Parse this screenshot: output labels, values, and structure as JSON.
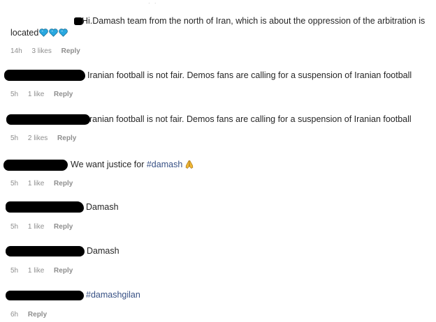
{
  "comments": [
    {
      "text_line1": "Hi.Damash team from the north of Iran, which is about the oppression of the arbitration is",
      "text_line2": "located",
      "time": "14h",
      "likes": "3 likes",
      "reply": "Reply"
    },
    {
      "text": "Iranian football is not fair. Demos fans are calling for a suspension of Iranian football",
      "time": "5h",
      "likes": "1 like",
      "reply": "Reply"
    },
    {
      "text": "ranian football is not fair. Demos fans are calling for a suspension of Iranian football",
      "time": "5h",
      "likes": "2 likes",
      "reply": "Reply"
    },
    {
      "text": "We want justice for ",
      "hashtag": "#damash",
      "time": "5h",
      "likes": "1 like",
      "reply": "Reply"
    },
    {
      "text": "Damash",
      "time": "5h",
      "likes": "1 like",
      "reply": "Reply"
    },
    {
      "text": "Damash",
      "time": "5h",
      "likes": "1 like",
      "reply": "Reply"
    },
    {
      "hashtag": "#damashgilan",
      "time": "6h",
      "reply": "Reply"
    }
  ],
  "colors": {
    "hashtag": "#385185",
    "meta": "#8e8e8e",
    "heart": "#29a8e0"
  },
  "icons": {
    "hearts": "blue-heart-icon",
    "pray": "folded-hands-icon"
  }
}
